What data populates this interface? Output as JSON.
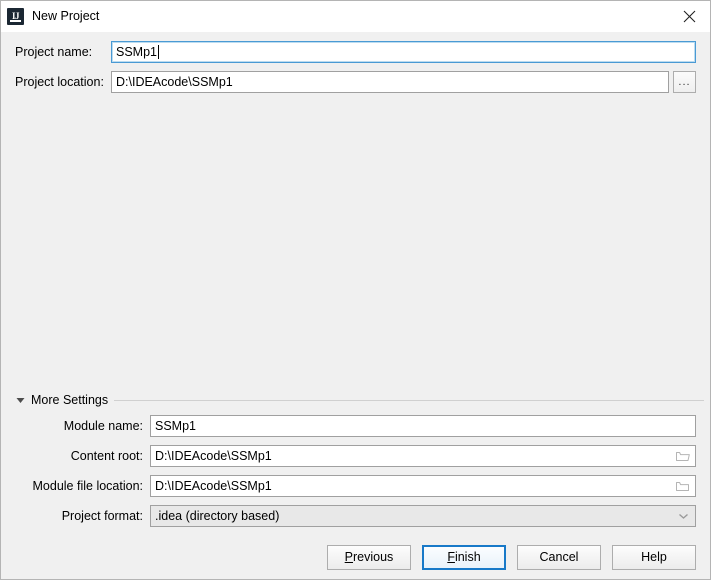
{
  "window": {
    "title": "New Project",
    "app_icon": "intellij-idea-icon",
    "close_icon": "close-icon"
  },
  "colors": {
    "panel_bg": "#f0f0f0",
    "titlebar_bg": "#ffffff",
    "field_bg": "#ffffff",
    "field_border": "#a0a0a0",
    "focus_blue": "#4a9ad4",
    "default_button_border": "#1879c8",
    "combo_bg": "#e8e8e8",
    "separator": "#d0d0d0"
  },
  "top_fields": {
    "project_name": {
      "label": "Project name:",
      "value": "SSMp1",
      "focused": true,
      "placeholder": ""
    },
    "project_location": {
      "label": "Project location:",
      "value": "D:\\IDEAcode\\SSMp1",
      "focused": false,
      "placeholder": "",
      "browse_button_label": "...",
      "browse_icon": "ellipsis-icon"
    }
  },
  "more_settings": {
    "label": "More Settings",
    "expanded": true,
    "twisty_icon": "triangle-down-icon",
    "fields": [
      {
        "label": "Module name:",
        "value": "SSMp1",
        "type": "text",
        "icon": "",
        "name": "module-name"
      },
      {
        "label": "Content root:",
        "value": "D:\\IDEAcode\\SSMp1",
        "type": "text",
        "icon": "folder-icon",
        "name": "content-root"
      },
      {
        "label": "Module file location:",
        "value": "D:\\IDEAcode\\SSMp1",
        "type": "text",
        "icon": "folder-icon",
        "name": "module-file-location"
      },
      {
        "label": "Project format:",
        "value": ".idea (directory based)",
        "type": "combo",
        "icon": "chevron-down-icon",
        "name": "project-format"
      }
    ]
  },
  "buttons": {
    "previous": {
      "label": "Previous",
      "mnemonic": "P",
      "default": false
    },
    "finish": {
      "label": "Finish",
      "mnemonic": "F",
      "default": true
    },
    "cancel": {
      "label": "Cancel",
      "mnemonic": "",
      "default": false
    },
    "help": {
      "label": "Help",
      "mnemonic": "",
      "default": false
    }
  }
}
